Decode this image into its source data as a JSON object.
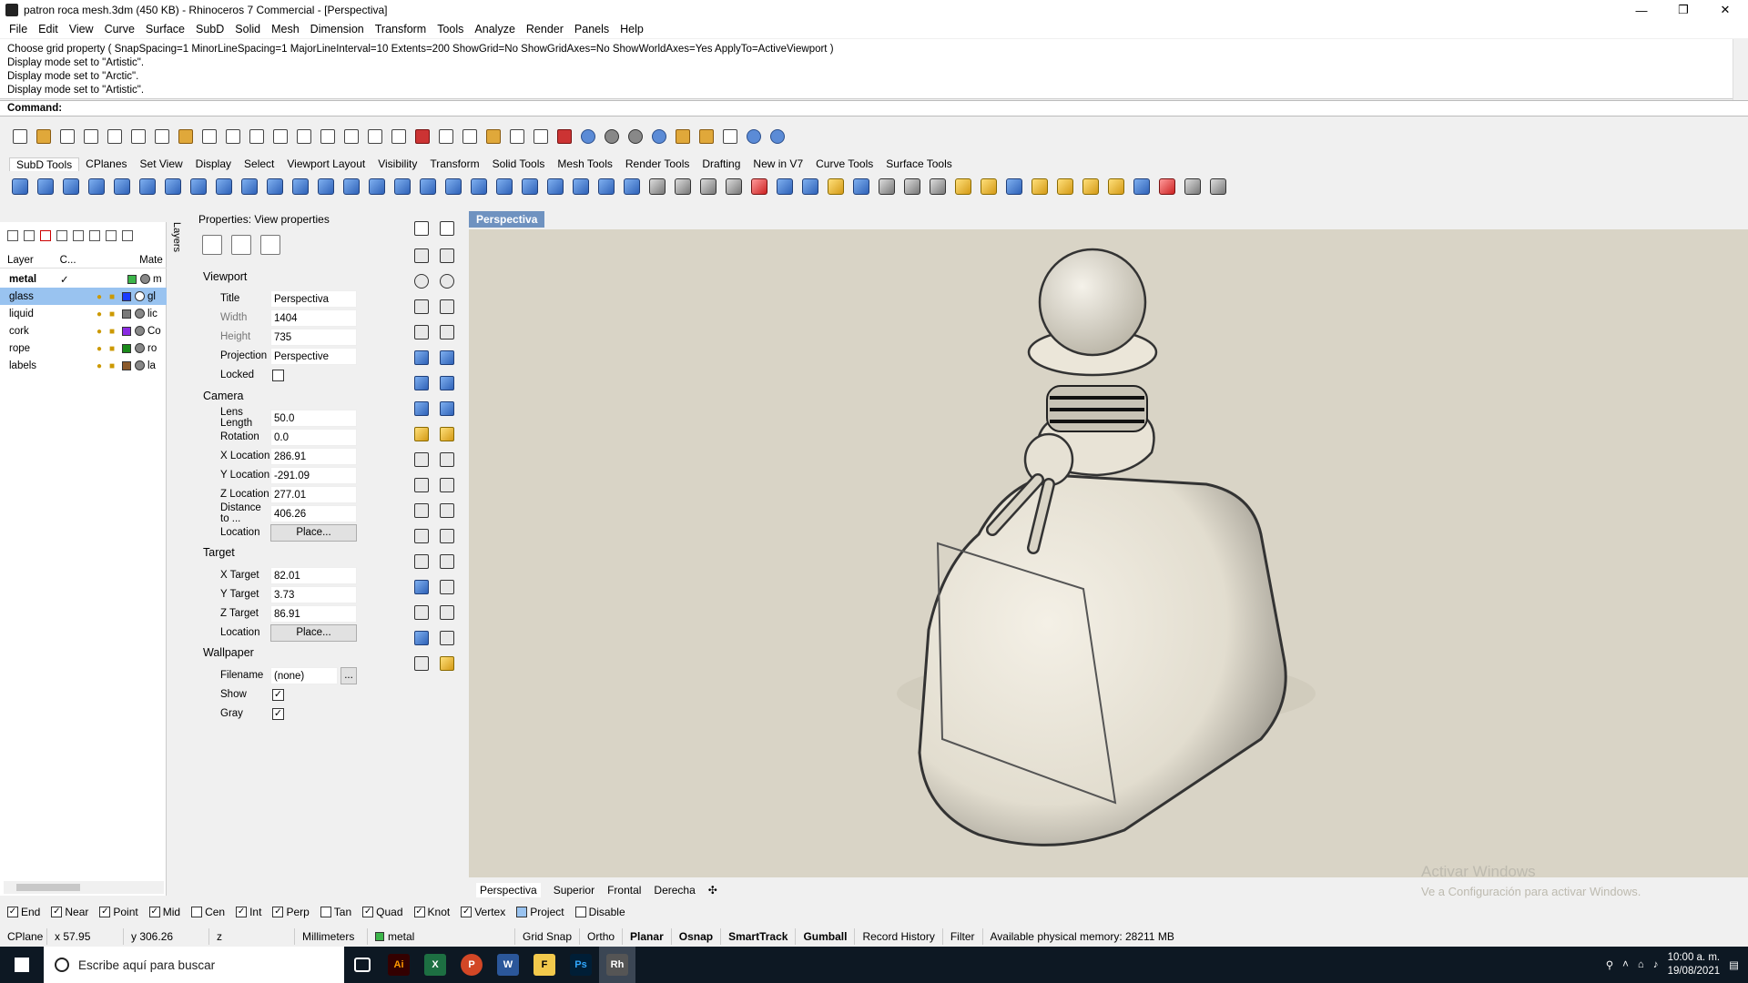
{
  "window": {
    "title": "patron roca mesh.3dm (450 KB) - Rhinoceros 7 Commercial - [Perspectiva]",
    "min": "—",
    "max": "❐",
    "close": "✕"
  },
  "menu": [
    "File",
    "Edit",
    "View",
    "Curve",
    "Surface",
    "SubD",
    "Solid",
    "Mesh",
    "Dimension",
    "Transform",
    "Tools",
    "Analyze",
    "Render",
    "Panels",
    "Help"
  ],
  "command": {
    "history": [
      "Choose grid property ( SnapSpacing=1  MinorLineSpacing=1  MajorLineInterval=10  Extents=200  ShowGrid=No  ShowGridAxes=No  ShowWorldAxes=Yes  ApplyTo=ActiveViewport )",
      "Display mode set to \"Artistic\".",
      "Display mode set to \"Arctic\".",
      "Display mode set to \"Artistic\"."
    ],
    "prompt": "Command:"
  },
  "toolbar_tabs": [
    "SubD Tools",
    "CPlanes",
    "Set View",
    "Display",
    "Select",
    "Viewport Layout",
    "Visibility",
    "Transform",
    "Solid Tools",
    "Mesh Tools",
    "Render Tools",
    "Drafting",
    "New in V7",
    "Curve Tools",
    "Surface Tools"
  ],
  "layers": {
    "side_tab": "Layers",
    "headers": {
      "layer": "Layer",
      "current": "C...",
      "material": "Mate"
    },
    "rows": [
      {
        "name": "metal",
        "current": "✓",
        "color": "#3cb54a",
        "mat": "m"
      },
      {
        "name": "glass",
        "current": "",
        "color": "#1a3cff",
        "mat": "gl"
      },
      {
        "name": "liquid",
        "current": "",
        "color": "#7a7a7a",
        "mat": "lic"
      },
      {
        "name": "cork",
        "current": "",
        "color": "#8a2be2",
        "mat": "Co"
      },
      {
        "name": "rope",
        "current": "",
        "color": "#1a8a1a",
        "mat": "ro"
      },
      {
        "name": "labels",
        "current": "",
        "color": "#8b5a2b",
        "mat": "la"
      }
    ]
  },
  "properties": {
    "title": "Properties: View properties",
    "viewport_section": "Viewport",
    "title_label": "Title",
    "title_val": "Perspectiva",
    "width_label": "Width",
    "width_val": "1404",
    "height_label": "Height",
    "height_val": "735",
    "projection_label": "Projection",
    "projection_val": "Perspective",
    "locked_label": "Locked",
    "camera_section": "Camera",
    "lens_label": "Lens Length",
    "lens_val": "50.0",
    "rotation_label": "Rotation",
    "rotation_val": "0.0",
    "xloc_label": "X Location",
    "xloc_val": "286.91",
    "yloc_label": "Y Location",
    "yloc_val": "-291.09",
    "zloc_label": "Z Location",
    "zloc_val": "277.01",
    "dist_label": "Distance to ...",
    "dist_val": "406.26",
    "location_label": "Location",
    "place_btn": "Place...",
    "target_section": "Target",
    "xt_label": "X Target",
    "xt_val": "82.01",
    "yt_label": "Y Target",
    "yt_val": "3.73",
    "zt_label": "Z Target",
    "zt_val": "86.91",
    "wallpaper_section": "Wallpaper",
    "filename_label": "Filename",
    "filename_val": "(none)",
    "browse_btn": "...",
    "show_label": "Show",
    "gray_label": "Gray"
  },
  "viewport": {
    "tab": "Perspectiva",
    "views": [
      "Perspectiva",
      "Superior",
      "Frontal",
      "Derecha"
    ],
    "watermark1": "Activar Windows",
    "watermark2": "Ve a Configuración para activar Windows."
  },
  "osnaps": [
    {
      "label": "End",
      "on": true
    },
    {
      "label": "Near",
      "on": true
    },
    {
      "label": "Point",
      "on": true
    },
    {
      "label": "Mid",
      "on": true
    },
    {
      "label": "Cen",
      "on": false
    },
    {
      "label": "Int",
      "on": true
    },
    {
      "label": "Perp",
      "on": true
    },
    {
      "label": "Tan",
      "on": false
    },
    {
      "label": "Quad",
      "on": true
    },
    {
      "label": "Knot",
      "on": true
    },
    {
      "label": "Vertex",
      "on": true
    },
    {
      "label": "Project",
      "on": false
    },
    {
      "label": "Disable",
      "on": false
    }
  ],
  "status": {
    "cplane": "CPlane",
    "x": "x 57.95",
    "y": "y 306.26",
    "z": "z",
    "units": "Millimeters",
    "layer": "metal",
    "gridsnap": "Grid Snap",
    "ortho": "Ortho",
    "planar": "Planar",
    "osnap": "Osnap",
    "smarttrack": "SmartTrack",
    "gumball": "Gumball",
    "record": "Record History",
    "filter": "Filter",
    "memory": "Available physical memory: 28211 MB"
  },
  "taskbar": {
    "search": "Escribe aquí para buscar",
    "time": "10:00 a. m.",
    "date": "19/08/2021",
    "apps": [
      {
        "name": "Ai",
        "color": "#ff7c00"
      },
      {
        "name": "X",
        "color": "#1d6f42"
      },
      {
        "name": "P",
        "color": "#d24726"
      },
      {
        "name": "W",
        "color": "#2b579a"
      },
      {
        "name": "F",
        "color": "#f2c94c"
      },
      {
        "name": "Ps",
        "color": "#31a8ff"
      },
      {
        "name": "Rh",
        "color": "#555"
      }
    ]
  }
}
